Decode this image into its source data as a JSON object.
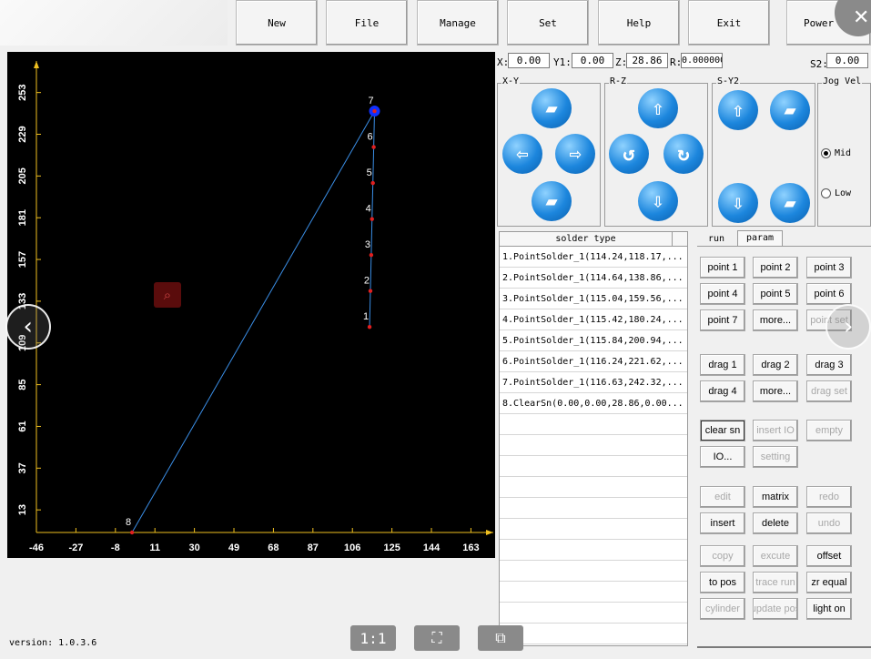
{
  "menu": {
    "new": "New",
    "file": "File",
    "manage": "Manage",
    "set": "Set",
    "help": "Help",
    "exit": "Exit",
    "power_off": "Power off"
  },
  "coords": {
    "x_label": "X:",
    "x_value": "0.00",
    "y1_label": "Y1:",
    "y1_value": "0.00",
    "z_label": "Z:",
    "z_value": "28.86",
    "r_label": "R:",
    "r_value": "0.000000",
    "s2_label": "S2:",
    "s2_value": "0.00"
  },
  "groups": {
    "xy": "X-Y",
    "rz": "R-Z",
    "sy2": "S-Y2",
    "jog": "Jog Vel"
  },
  "jog": {
    "mid": "Mid",
    "low": "Low",
    "selected": "Mid"
  },
  "list": {
    "header": "solder type",
    "rows": [
      "1.PointSolder_1(114.24,118.17,...",
      "2.PointSolder_1(114.64,138.86,...",
      "3.PointSolder_1(115.04,159.56,...",
      "4.PointSolder_1(115.42,180.24,...",
      "5.PointSolder_1(115.84,200.94,...",
      "6.PointSolder_1(116.24,221.62,...",
      "7.PointSolder_1(116.63,242.32,...",
      "8.ClearSn(0.00,0.00,28.86,0.00..."
    ]
  },
  "tabs": {
    "run": "run",
    "param": "param",
    "active": "param"
  },
  "buttons": {
    "point1": "point 1",
    "point2": "point 2",
    "point3": "point 3",
    "point4": "point 4",
    "point5": "point 5",
    "point6": "point 6",
    "point7": "point 7",
    "more1": "more...",
    "point_set": "point set",
    "drag1": "drag 1",
    "drag2": "drag 2",
    "drag3": "drag 3",
    "drag4": "drag 4",
    "more2": "more...",
    "drag_set": "drag set",
    "clear_sn": "clear sn",
    "insert_io": "insert IO",
    "empty": "empty",
    "io": "IO...",
    "setting": "setting",
    "edit": "edit",
    "matrix": "matrix",
    "redo": "redo",
    "insert": "insert",
    "delete": "delete",
    "undo": "undo",
    "copy": "copy",
    "excute": "excute",
    "offset": "offset",
    "to_pos": "to pos",
    "trace_run": "trace run",
    "zr_equal": "zr equal",
    "cylinder": "cylinder",
    "update_pos": "update pos",
    "light_on": "light on"
  },
  "version": "version: 1.0.3.6",
  "viewer": {
    "one_to_one": "1:1"
  },
  "chart_data": {
    "type": "scatter",
    "x_ticks": [
      "-46",
      "-27",
      "-8",
      "11",
      "30",
      "49",
      "68",
      "87",
      "106",
      "125",
      "144",
      "163"
    ],
    "y_ticks": [
      "13",
      "37",
      "61",
      "85",
      "109",
      "133",
      "157",
      "181",
      "205",
      "229",
      "253"
    ],
    "xlim": [
      -46,
      172
    ],
    "ylim": [
      0,
      268
    ],
    "points": [
      {
        "label": "1",
        "x": 114.24,
        "y": 118.17
      },
      {
        "label": "2",
        "x": 114.64,
        "y": 138.86
      },
      {
        "label": "3",
        "x": 115.04,
        "y": 159.56
      },
      {
        "label": "4",
        "x": 115.42,
        "y": 180.24
      },
      {
        "label": "5",
        "x": 115.84,
        "y": 200.94
      },
      {
        "label": "6",
        "x": 116.24,
        "y": 221.62
      },
      {
        "label": "7",
        "x": 116.63,
        "y": 242.32
      },
      {
        "label": "8",
        "x": 0.0,
        "y": 0.0
      }
    ],
    "colors": {
      "background": "#000000",
      "axis": "#f0c020",
      "tick_text": "#ffffff",
      "path": "#3a8ee6",
      "point": "#e02020",
      "current": "#1030ff"
    }
  }
}
